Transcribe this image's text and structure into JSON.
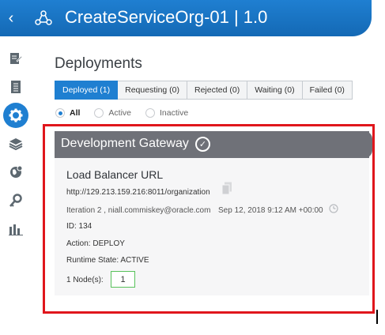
{
  "titlebar": {
    "title": "CreateServiceOrg-01 | 1.0",
    "back_icon": "chevron-left-icon",
    "org_icon": "org-nodes-icon"
  },
  "leftnav": {
    "items": [
      {
        "name": "edit-doc-icon"
      },
      {
        "name": "list-doc-icon"
      },
      {
        "name": "gear-icon",
        "active": true
      },
      {
        "name": "layers-icon"
      },
      {
        "name": "globe-icon"
      },
      {
        "name": "key-icon"
      },
      {
        "name": "bar-chart-icon"
      }
    ]
  },
  "page": {
    "heading": "Deployments"
  },
  "tabs": [
    {
      "label": "Deployed (1)",
      "selected": true
    },
    {
      "label": "Requesting (0)"
    },
    {
      "label": "Rejected (0)"
    },
    {
      "label": "Waiting (0)"
    },
    {
      "label": "Failed (0)"
    }
  ],
  "filters": {
    "all": "All",
    "active": "Active",
    "inactive": "Inactive",
    "selected": "All"
  },
  "card": {
    "title": "Development Gateway",
    "lb_title": "Load Balancer URL",
    "url": "http://129.213.159.216:8011/organization",
    "iteration": "Iteration 2 , niall.commiskey@oracle.com",
    "date": "Sep 12, 2018 9:12 AM +00:00",
    "id": "ID: 134",
    "action": "Action: DEPLOY",
    "runtime_state": "Runtime State: ACTIVE",
    "nodes_label": "1 Node(s):",
    "nodes_value": "1"
  },
  "colors": {
    "accent": "#1f7fd1",
    "card_header": "#6f7178",
    "highlight": "#e0161c",
    "node_box_border": "#58c25b"
  }
}
